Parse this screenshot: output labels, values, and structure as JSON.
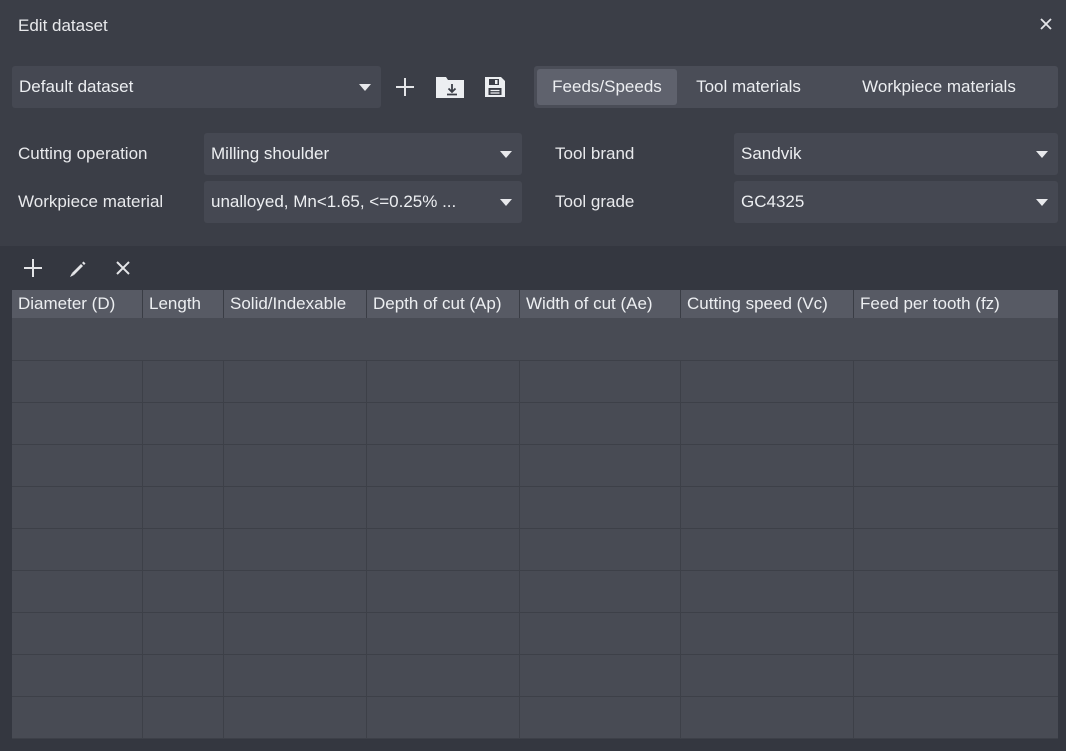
{
  "window": {
    "title": "Edit dataset"
  },
  "dataset": {
    "selected": "Default dataset"
  },
  "tabs": [
    {
      "label": "Feeds/Speeds",
      "active": true
    },
    {
      "label": "Tool materials",
      "active": false
    },
    {
      "label": "Workpiece materials",
      "active": false
    }
  ],
  "form": {
    "cutting_operation_label": "Cutting operation",
    "cutting_operation_value": "Milling shoulder",
    "workpiece_material_label": "Workpiece material",
    "workpiece_material_value": "unalloyed,  Mn<1.65, <=0.25% ...",
    "tool_brand_label": "Tool brand",
    "tool_brand_value": "Sandvik",
    "tool_grade_label": "Tool grade",
    "tool_grade_value": "GC4325"
  },
  "table": {
    "columns": [
      "Diameter (D)",
      "Length",
      "Solid/Indexable",
      "Depth of cut (Ap)",
      "Width of cut (Ae)",
      "Cutting speed (Vc)",
      "Feed per tooth (fz)"
    ],
    "rows": []
  },
  "icons": {
    "close": "close-icon",
    "add_dataset": "plus-icon",
    "import_dataset": "folder-import-icon",
    "save_dataset": "save-icon",
    "add_row": "plus-icon",
    "edit_row": "pencil-icon",
    "delete_row": "x-icon"
  }
}
